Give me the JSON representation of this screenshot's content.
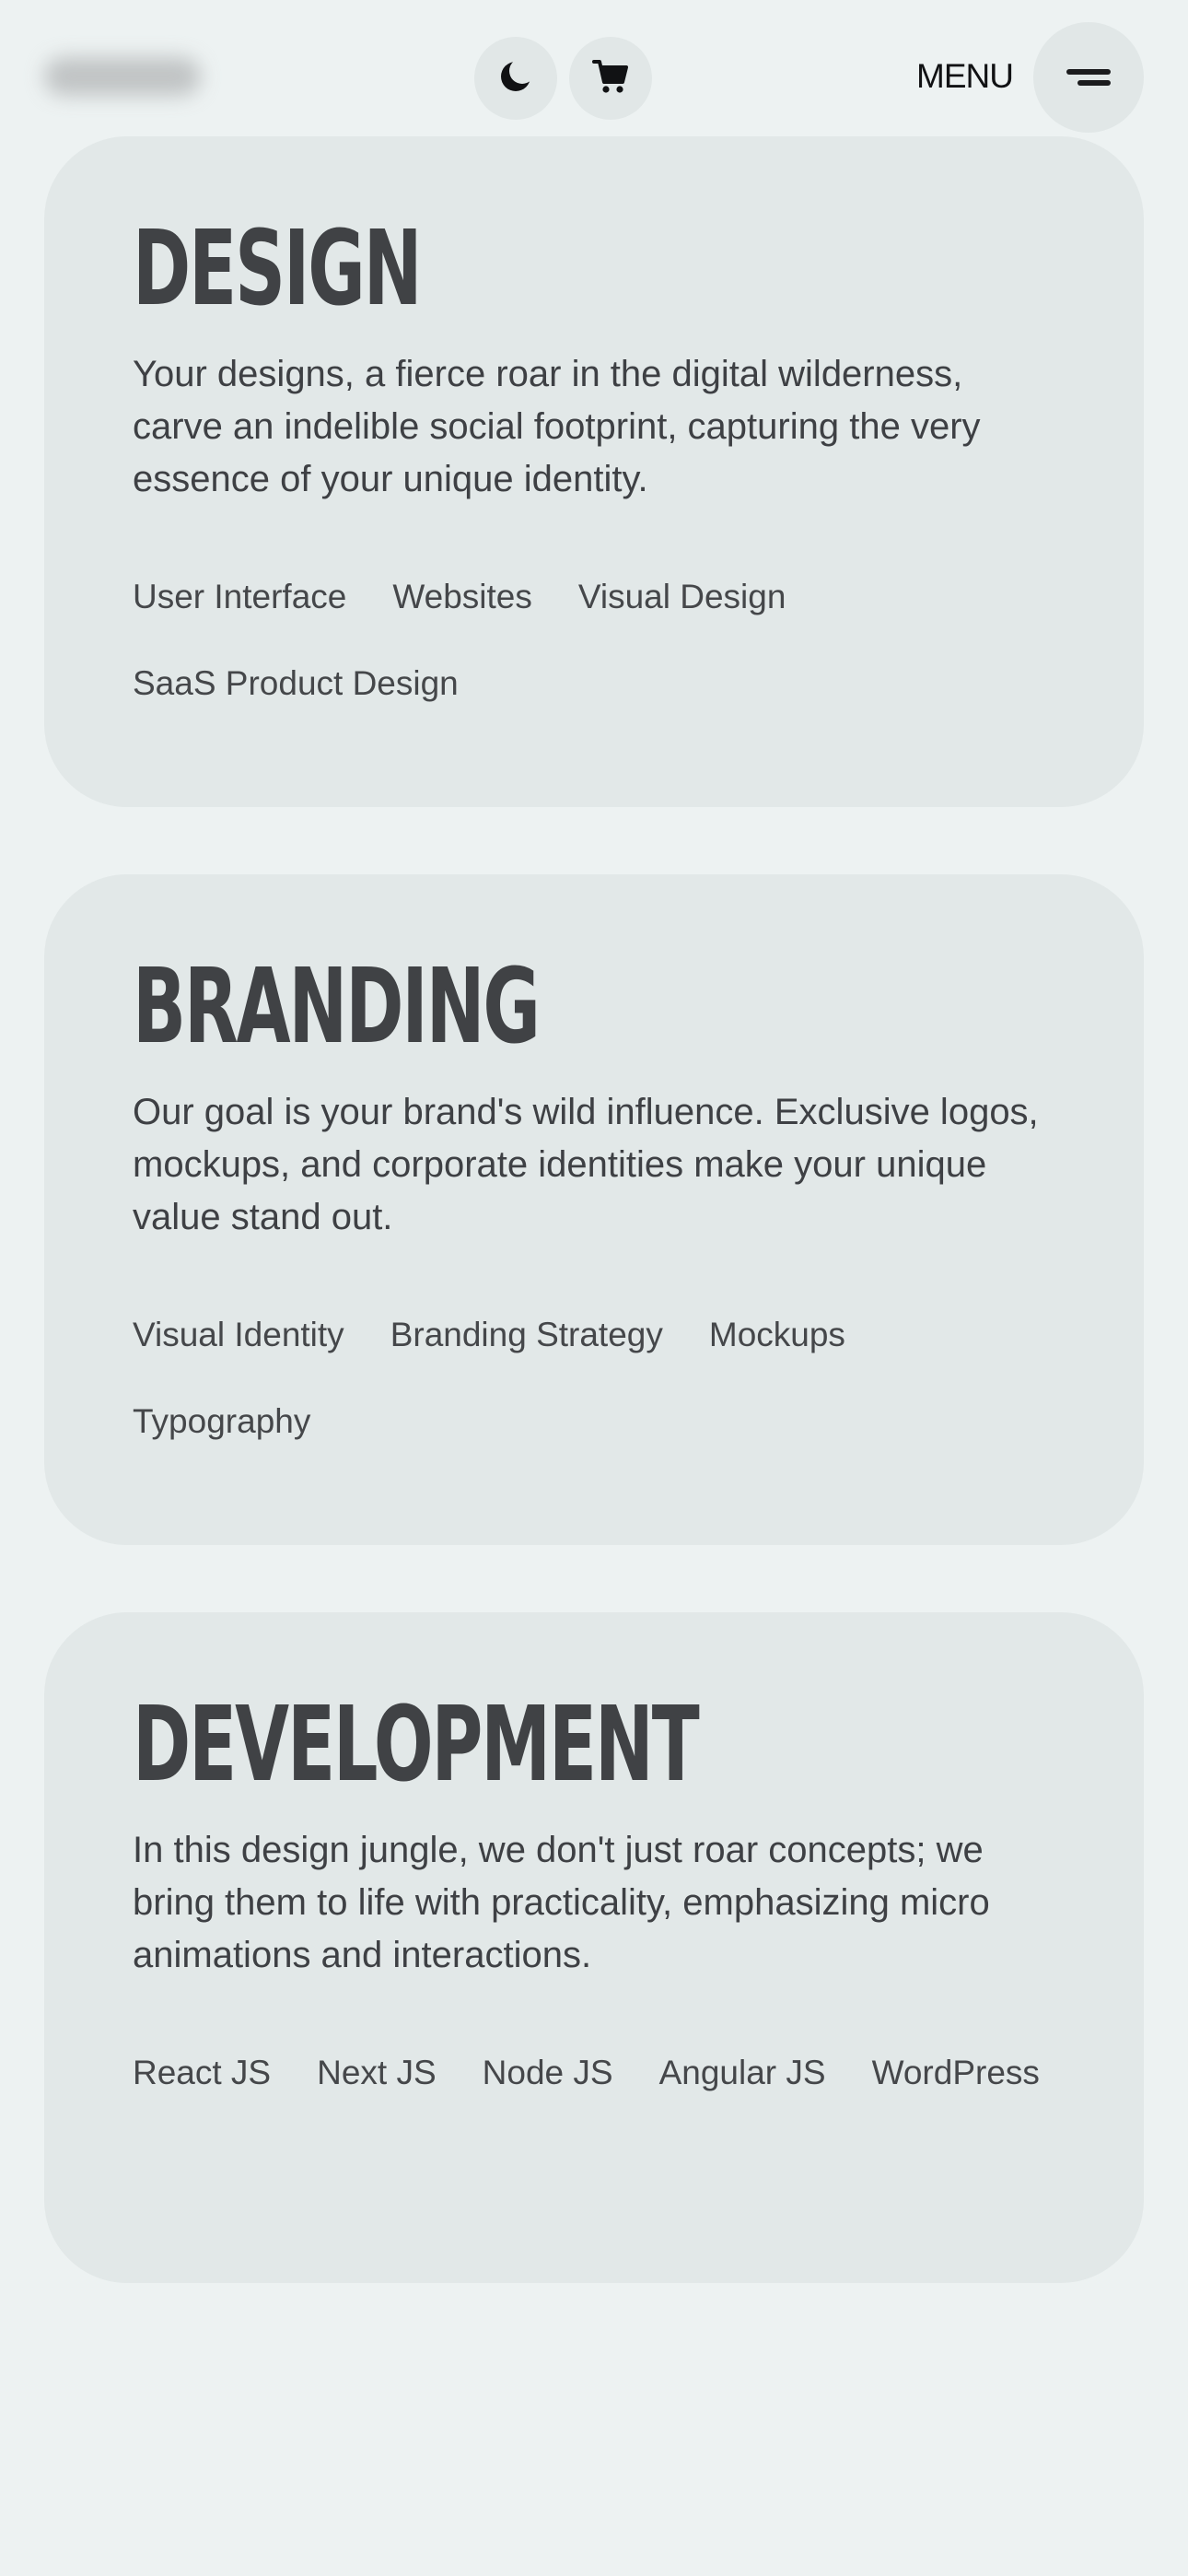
{
  "header": {
    "menu_label": "MENU",
    "icons": {
      "theme": "moon-icon",
      "cart": "cart-icon",
      "menu": "hamburger-menu-icon"
    }
  },
  "services": [
    {
      "title": "DESIGN",
      "description": "Your designs, a fierce roar in the digital wilderness, carve an indelible social footprint, capturing the very essence of your unique identity.",
      "tags": [
        "User Interface",
        "Websites",
        "Visual Design",
        "SaaS Product Design"
      ]
    },
    {
      "title": "BRANDING",
      "description": "Our goal is your brand's wild influence. Exclusive logos, mockups, and corporate identities make your unique value stand out.",
      "tags": [
        "Visual Identity",
        "Branding Strategy",
        "Mockups",
        "Typography"
      ]
    },
    {
      "title": "DEVELOPMENT",
      "description": "In this design jungle, we don't just roar concepts; we bring them to life with practicality, emphasizing micro animations and interactions.",
      "tags": [
        "React JS",
        "Next JS",
        "Node JS",
        "Angular JS",
        "WordPress"
      ]
    }
  ],
  "colors": {
    "page_background": "#edf2f2",
    "card_background": "#e2e8e8",
    "title_text": "#404245",
    "body_text": "#3e4044",
    "icon": "#111214"
  }
}
